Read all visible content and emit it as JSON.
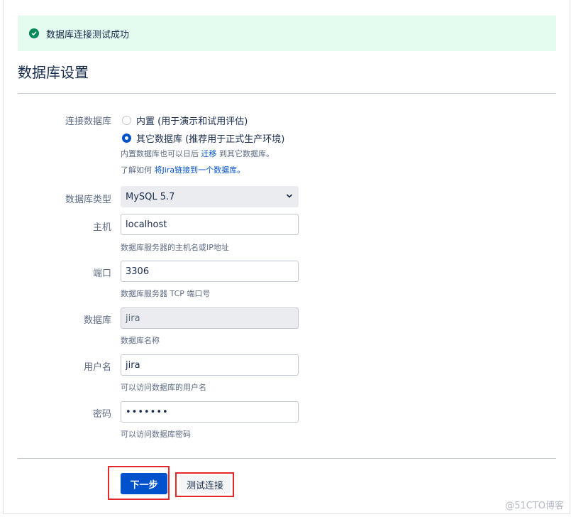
{
  "banner": {
    "message": "数据库连接测试成功",
    "icon": "check-circle-icon"
  },
  "title": "数据库设置",
  "connection": {
    "label": "连接数据库",
    "options": [
      {
        "label": "内置 (用于演示和试用评估)",
        "selected": false
      },
      {
        "label": "其它数据库 (推荐用于正式生产环境)",
        "selected": true
      }
    ],
    "hint1_prefix": "内置数据库也可以日后",
    "hint1_link": "迁移",
    "hint1_suffix": "到其它数据库。",
    "hint2_prefix": "了解如何",
    "hint2_link": "将Jira链接到一个数据库。"
  },
  "fields": {
    "db_type": {
      "label": "数据库类型",
      "value": "MySQL 5.7"
    },
    "host": {
      "label": "主机",
      "value": "localhost",
      "hint": "数据库服务器的主机名或IP地址"
    },
    "port": {
      "label": "端口",
      "value": "3306",
      "hint": "数据库服务器 TCP 端口号"
    },
    "database": {
      "label": "数据库",
      "value": "jira",
      "hint": "数据库名称"
    },
    "username": {
      "label": "用户名",
      "value": "jira",
      "hint": "可以访问数据库的用户名"
    },
    "password": {
      "label": "密码",
      "value": "•••••••",
      "hint": "可以访问数据库密码"
    }
  },
  "buttons": {
    "next": "下一步",
    "test": "测试连接"
  },
  "watermark": "@51CTO博客",
  "colors": {
    "primary": "#0052cc",
    "success_bg": "#e3fcef",
    "success_icon": "#00875a",
    "highlight": "#e52727"
  }
}
